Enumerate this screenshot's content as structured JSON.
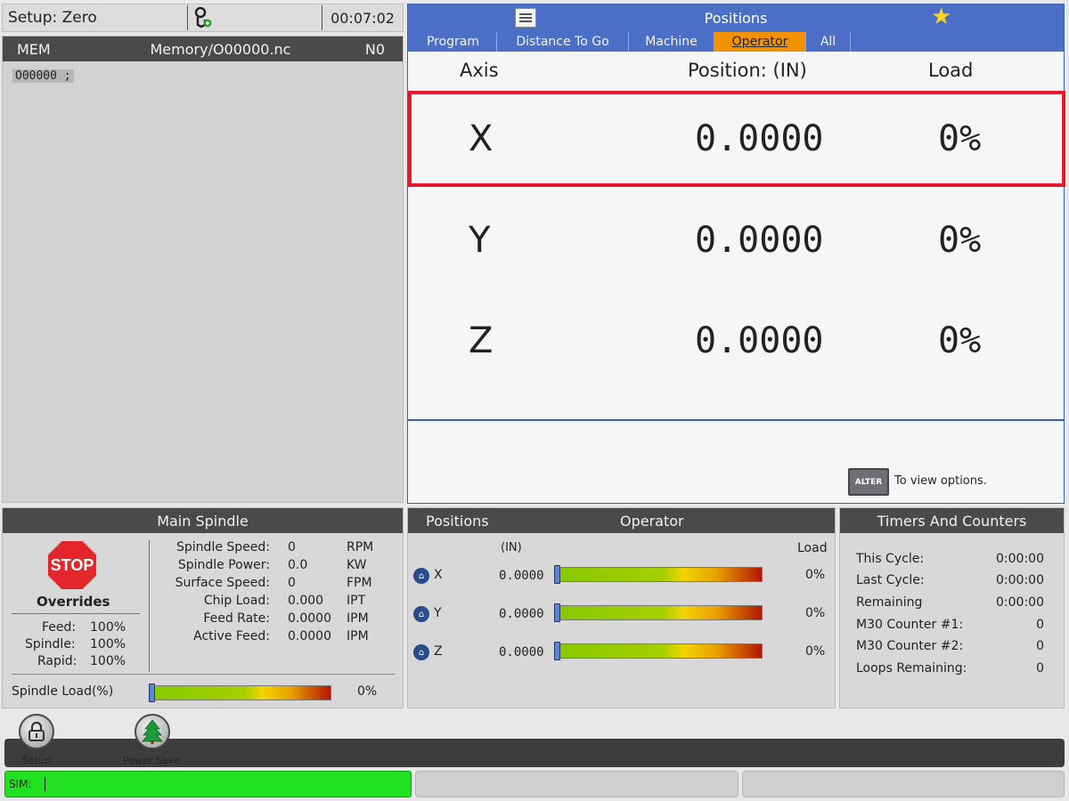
{
  "status": {
    "mode": "Setup: Zero",
    "time": "00:07:02"
  },
  "program": {
    "source": "MEM",
    "file": "Memory/O00000.nc",
    "line": "N0",
    "code": "O00000 ;"
  },
  "positions_panel": {
    "title": "Positions",
    "tabs": [
      {
        "label": "Program"
      },
      {
        "label": "Distance To Go"
      },
      {
        "label": "Machine"
      },
      {
        "label": "Operator"
      },
      {
        "label": "All"
      }
    ],
    "active_tab": "Operator",
    "columns": {
      "axis": "Axis",
      "position": "Position:  (IN)",
      "load": "Load"
    },
    "rows": [
      {
        "axis": "X",
        "position": "0.0000",
        "load": "0%"
      },
      {
        "axis": "Y",
        "position": "0.0000",
        "load": "0%"
      },
      {
        "axis": "Z",
        "position": "0.0000",
        "load": "0%"
      }
    ],
    "alter_label": "ALTER",
    "alter_hint": "To view options.",
    "highlight_color": "#e8192c",
    "accent_color": "#4b6ec7"
  },
  "spindle": {
    "title": "Main Spindle",
    "stop_label": "STOP",
    "overrides_label": "Overrides",
    "overrides": [
      {
        "label": "Feed:",
        "value": "100%"
      },
      {
        "label": "Spindle:",
        "value": "100%"
      },
      {
        "label": "Rapid:",
        "value": "100%"
      }
    ],
    "stats": [
      {
        "label": "Spindle Speed:",
        "value": "0",
        "unit": "RPM"
      },
      {
        "label": "Spindle Power:",
        "value": "0.0",
        "unit": "KW"
      },
      {
        "label": "Surface Speed:",
        "value": "0",
        "unit": "FPM"
      },
      {
        "label": "Chip Load:",
        "value": "0.000",
        "unit": "IPT"
      },
      {
        "label": "Feed Rate:",
        "value": "0.0000",
        "unit": "IPM"
      },
      {
        "label": "Active Feed:",
        "value": "0.0000",
        "unit": "IPM"
      }
    ],
    "load_label": "Spindle Load(%)",
    "load_value": "0%",
    "load_fraction": 0
  },
  "positions_small": {
    "title_left": "Positions",
    "title_right": "Operator",
    "unit": "(IN)",
    "load_header": "Load",
    "rows": [
      {
        "axis": "X",
        "position": "0.0000",
        "load": "0%"
      },
      {
        "axis": "Y",
        "position": "0.0000",
        "load": "0%"
      },
      {
        "axis": "Z",
        "position": "0.0000",
        "load": "0%"
      }
    ]
  },
  "timers": {
    "title": "Timers And Counters",
    "items": [
      {
        "label": "This Cycle:",
        "value": "0:00:00"
      },
      {
        "label": "Last Cycle:",
        "value": "0:00:00"
      },
      {
        "label": "Remaining",
        "value": "0:00:00"
      },
      {
        "label": "M30 Counter #1:",
        "value": "0"
      },
      {
        "label": "M30 Counter #2:",
        "value": "0"
      },
      {
        "label": "Loops Remaining:",
        "value": "0"
      }
    ]
  },
  "toolbar": {
    "setup_label": "Setup",
    "powersave_label": "Power Save"
  },
  "sim": {
    "label": "SIM:",
    "color": "#21e021"
  },
  "icons": [
    "jog-handle-icon",
    "menu-icon",
    "favorite-star-icon",
    "stop-sign-icon",
    "home-icon",
    "lock-icon",
    "tree-icon"
  ]
}
